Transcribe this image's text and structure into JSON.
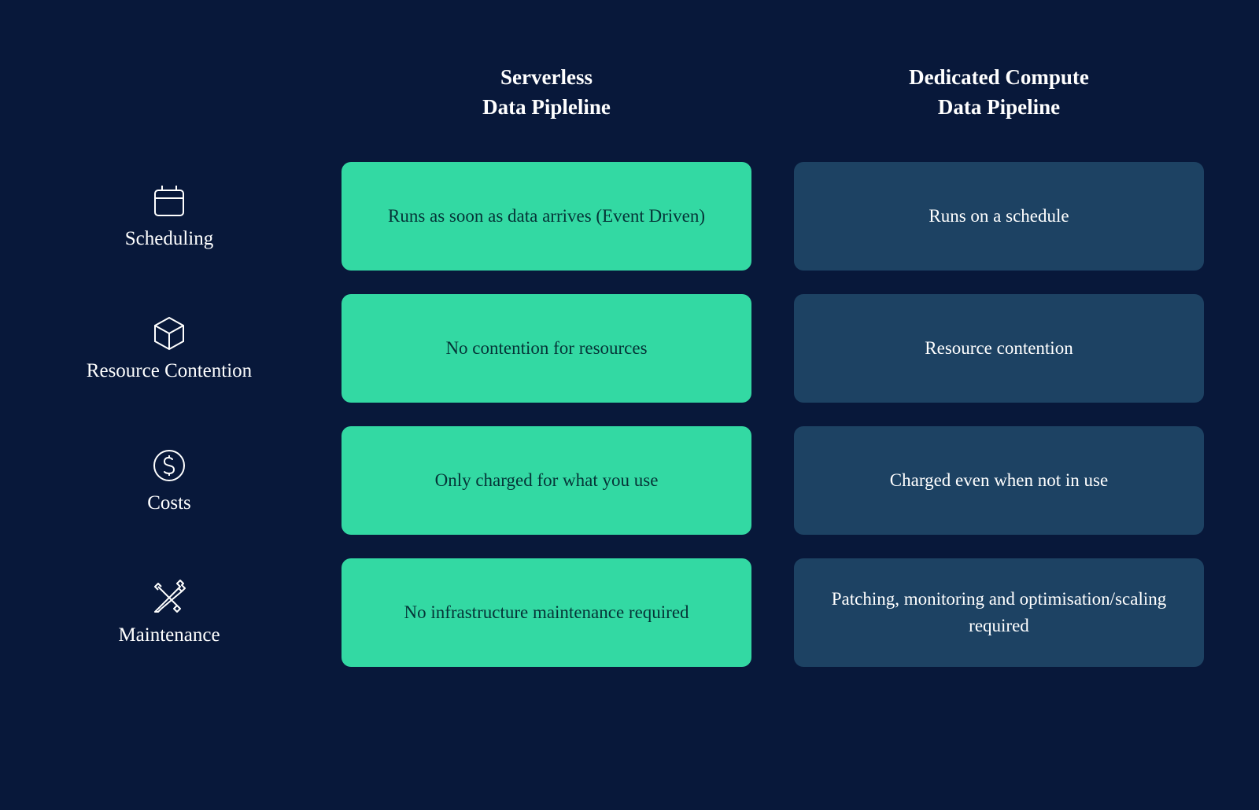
{
  "headers": {
    "col1_line1": "Serverless",
    "col1_line2": "Data Pipleline",
    "col2_line1": "Dedicated Compute",
    "col2_line2": "Data Pipeline"
  },
  "rows": [
    {
      "label": "Scheduling",
      "icon": "calendar-icon",
      "serverless": "Runs as soon as data arrives (Event Driven)",
      "dedicated": "Runs on a schedule"
    },
    {
      "label": "Resource Contention",
      "icon": "cube-icon",
      "serverless": "No contention for resources",
      "dedicated": "Resource contention"
    },
    {
      "label": "Costs",
      "icon": "dollar-icon",
      "serverless": "Only charged for what you use",
      "dedicated": "Charged even when not in use"
    },
    {
      "label": "Maintenance",
      "icon": "tools-icon",
      "serverless": "No infrastructure maintenance required",
      "dedicated": "Patching, monitoring and optimisation/scaling required"
    }
  ],
  "colors": {
    "background": "#08183a",
    "green": "#33d9a3",
    "blue": "#1d4263"
  }
}
